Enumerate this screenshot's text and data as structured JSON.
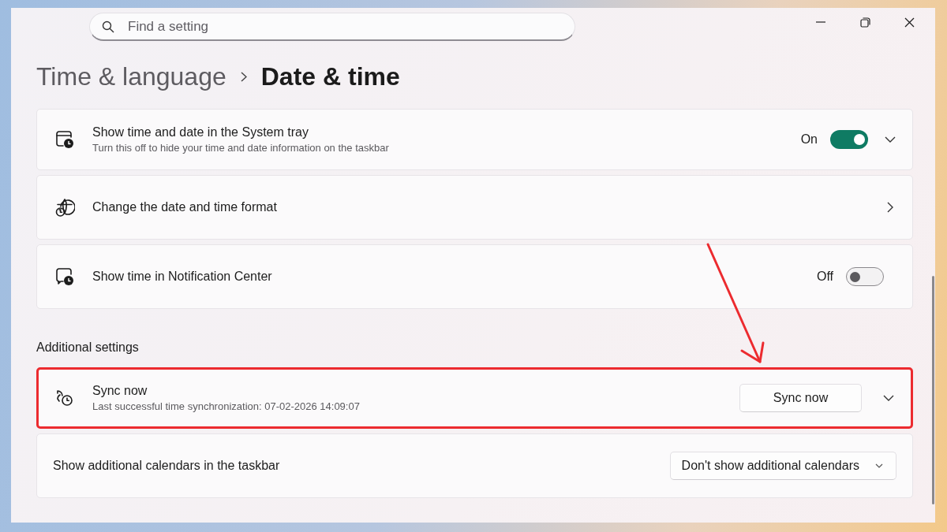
{
  "search": {
    "placeholder": "Find a setting"
  },
  "breadcrumb": [
    {
      "label": "Time & language",
      "current": false
    },
    {
      "label": "Date & time",
      "current": true
    }
  ],
  "sections": [
    {
      "settings": [
        {
          "kind": "toggle",
          "title": "Show time and date in the System tray",
          "description": "Turn this off to hide your time and date information on the taskbar",
          "state_label": "On",
          "on": true,
          "expandable": true
        },
        {
          "kind": "link",
          "title": "Change the date and time format"
        },
        {
          "kind": "toggle",
          "title": "Show time in Notification Center",
          "state_label": "Off",
          "on": false,
          "expandable": false
        }
      ]
    },
    {
      "heading": "Additional settings",
      "settings": [
        {
          "kind": "action",
          "title": "Sync now",
          "description": "Last successful time synchronization: 07-02-2026 14:09:07",
          "button": "Sync now",
          "expandable": true,
          "highlighted": true
        },
        {
          "kind": "select",
          "title": "Show additional calendars in the taskbar",
          "value": "Don't show additional calendars",
          "highlighted": false
        }
      ]
    }
  ]
}
